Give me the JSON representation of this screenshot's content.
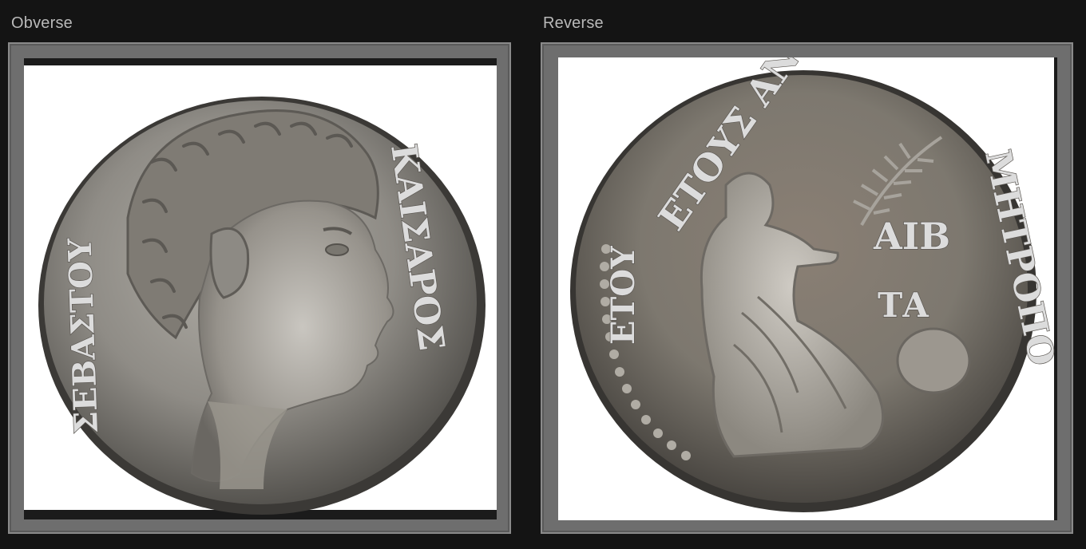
{
  "viewer": {
    "obverse": {
      "caption": "Obverse",
      "legend": "ΚΑΙΣΑΡΟΣ ΣΕΒΑΣΤΟΥ",
      "legend_right": "ΚΑΙΣΑΡΟΣ",
      "legend_left": "ΣΕΒΑΣΤΟΥ"
    },
    "reverse": {
      "caption": "Reverse",
      "legend_top": "ΕΤΟΥΣ ΑΝΤΙΟΧΕΩΝ",
      "legend_right": "ΜΗΤΡΟΠΟ",
      "field_letters_1": "ΑΙΒ",
      "field_letters_2": "ΤΑ",
      "left_letters": "ΕΤΟΥ"
    }
  },
  "colors": {
    "background": "#141414",
    "frame": "#6e6e6e",
    "caption_text": "#b9b9b9",
    "coin_silver": "#8f8c86"
  }
}
